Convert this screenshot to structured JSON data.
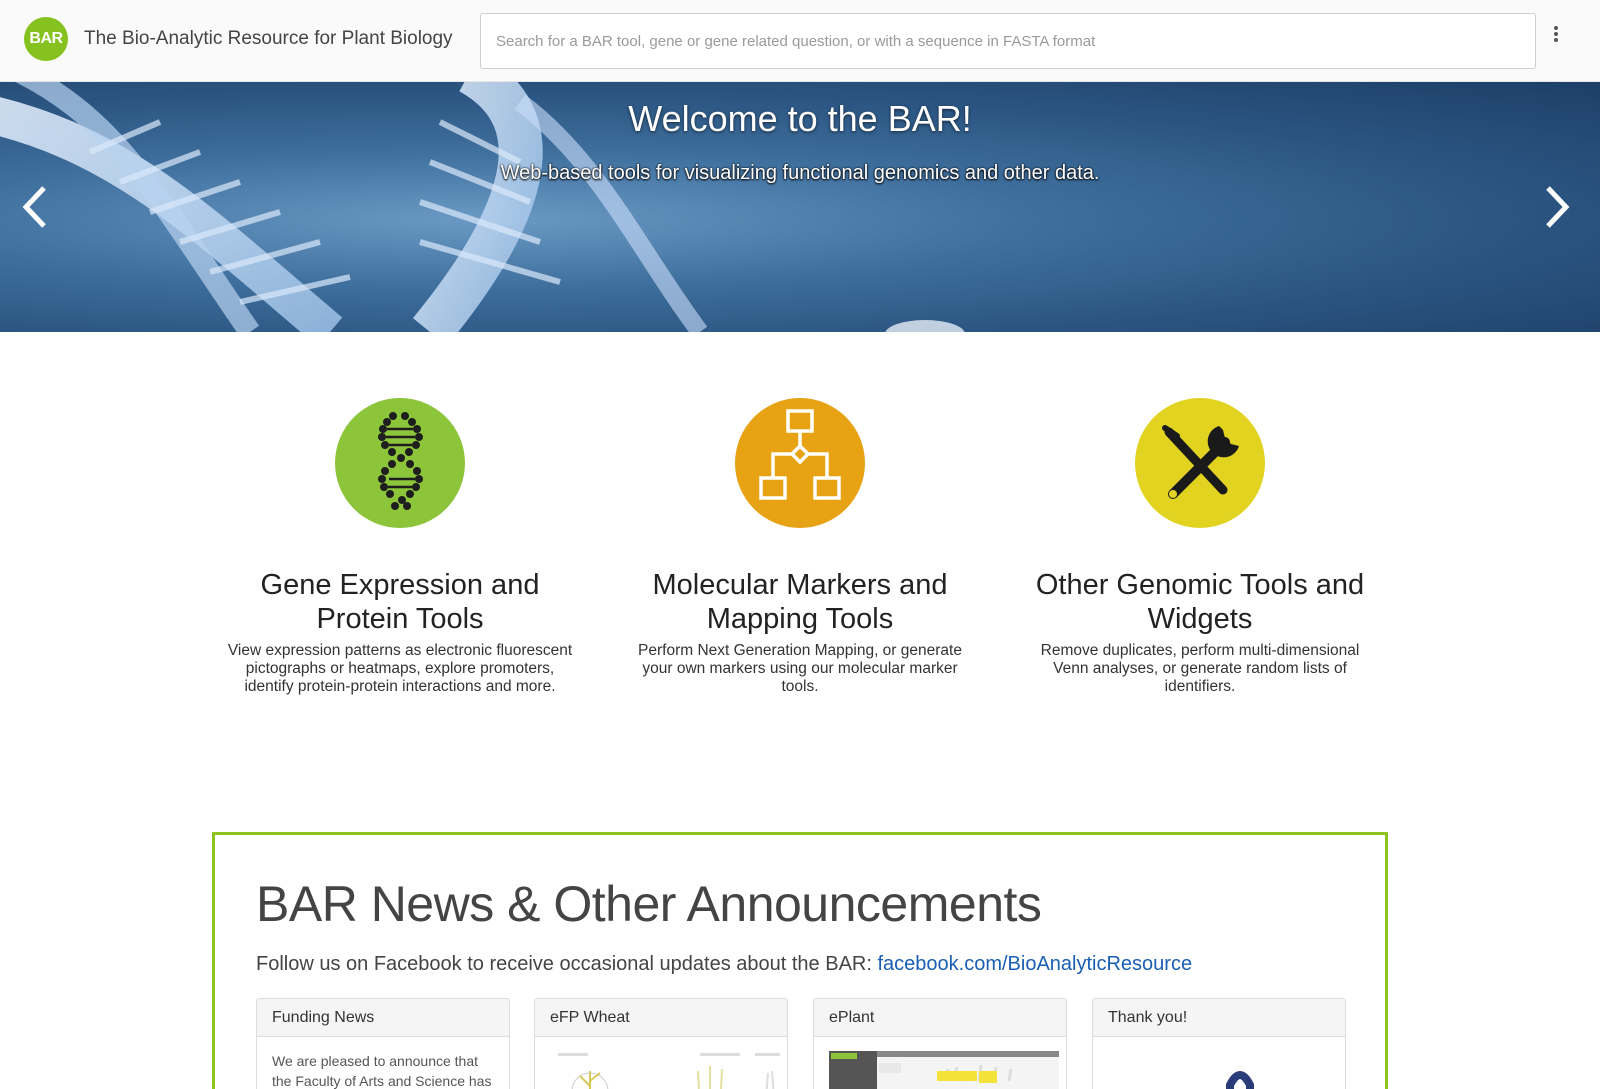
{
  "header": {
    "logo_text": "BAR",
    "title": "The Bio-Analytic Resource for Plant Biology",
    "search_placeholder": "Search for a BAR tool, gene or gene related question, or with a sequence in FASTA format"
  },
  "hero": {
    "title": "Welcome to the BAR!",
    "subtitle": "Web-based tools for visualizing functional genomics and other data."
  },
  "features": [
    {
      "icon": "dna-icon",
      "color": "#8cc43a",
      "title": "Gene Expression and Protein Tools",
      "description": "View expression patterns as electronic fluorescent pictographs or heatmaps, explore promoters, identify protein-protein interactions and more."
    },
    {
      "icon": "flowchart-icon",
      "color": "#e8a315",
      "title": "Molecular Markers and Mapping Tools",
      "description": "Perform Next Generation Mapping, or generate your own markers using our molecular marker tools."
    },
    {
      "icon": "tools-icon",
      "color": "#e2d321",
      "title": "Other Genomic Tools and Widgets",
      "description": "Remove duplicates, perform multi-dimensional Venn analyses, or generate random lists of identifiers."
    }
  ],
  "news": {
    "title": "BAR News & Other Announcements",
    "follow_text": "Follow us on Facebook to receive occasional updates about the BAR: ",
    "facebook_link": "facebook.com/BioAnalyticResource",
    "cards": [
      {
        "title": "Funding News",
        "body": "We are pleased to announce that the Faculty of Arts and Science has"
      },
      {
        "title": "eFP Wheat",
        "body": ""
      },
      {
        "title": "ePlant",
        "body": ""
      },
      {
        "title": "Thank you!",
        "body": ""
      }
    ]
  },
  "colors": {
    "brand_green": "#86c21f",
    "news_border": "#8fc31f",
    "link": "#1a5fb4"
  }
}
